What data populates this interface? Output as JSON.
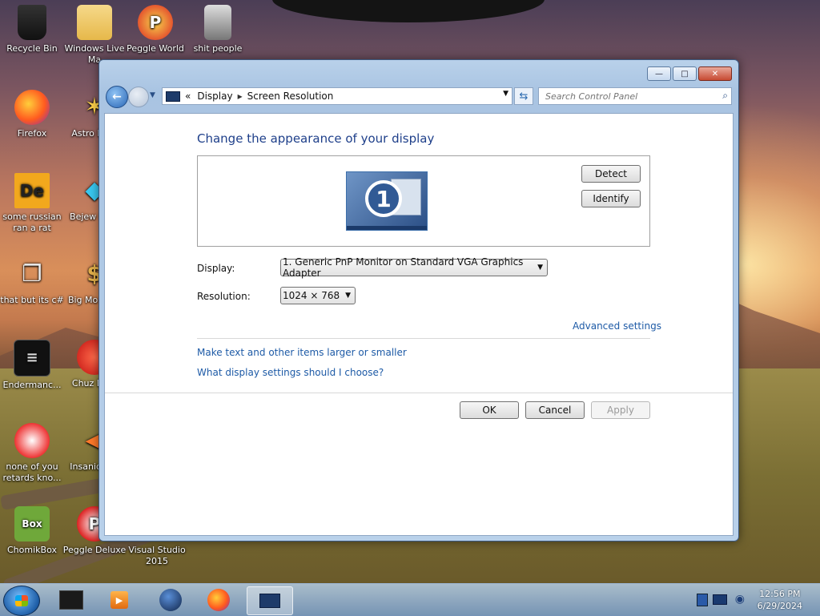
{
  "desktop": {
    "icons": [
      {
        "label": "Recycle Bin",
        "icon": "recycle-bin-icon"
      },
      {
        "label": "Windows Live Ma",
        "icon": "windows-live-mail-icon"
      },
      {
        "label": "Peggle World",
        "icon": "peggle-icon"
      },
      {
        "label": "shit people",
        "icon": "folder-icon"
      },
      {
        "label": "Firefox",
        "icon": "firefox-icon"
      },
      {
        "label": "Astro Delu",
        "icon": "astro-icon"
      },
      {
        "label": "some russian ran a rat",
        "icon": "de-icon"
      },
      {
        "label": "Bejew Delu",
        "icon": "gem-icon"
      },
      {
        "label": "that but its c#",
        "icon": "copy-icon"
      },
      {
        "label": "Big Mo Delu",
        "icon": "money-bag-icon"
      },
      {
        "label": "Endermanc...",
        "icon": "console-icon"
      },
      {
        "label": "Chuz Delu",
        "icon": "chuzzle-icon"
      },
      {
        "label": "none of you retards kno...",
        "icon": "dragon-icon"
      },
      {
        "label": "Insaniq Del",
        "icon": "fish-icon"
      },
      {
        "label": "ChomikBox",
        "icon": "chomikbox-icon"
      },
      {
        "label": "Peggle Deluxe",
        "icon": "peggle-deluxe-icon"
      },
      {
        "label": "Visual Studio 2015",
        "icon": "visual-studio-icon"
      }
    ]
  },
  "window": {
    "caption": {
      "minimize": "—",
      "maximize": "□",
      "close": "✕"
    },
    "address": {
      "prefix": "«",
      "crumb1": "Display",
      "sep": "▸",
      "crumb2": "Screen Resolution"
    },
    "search_placeholder": "Search Control Panel",
    "heading": "Change the appearance of your display",
    "monitor_number": "1",
    "detect_label": "Detect",
    "identify_label": "Identify",
    "display_label": "Display:",
    "display_value": "1. Generic PnP Monitor on Standard VGA Graphics Adapter",
    "resolution_label": "Resolution:",
    "resolution_value": "1024 × 768",
    "advanced_link": "Advanced settings",
    "link_text_size": "Make text and other items larger or smaller",
    "link_which_settings": "What display settings should I choose?",
    "ok_label": "OK",
    "cancel_label": "Cancel",
    "apply_label": "Apply"
  },
  "taskbar": {
    "items": [
      "start",
      "dark-app-icon",
      "media-player-icon",
      "globe-icon",
      "firefox-icon",
      "control-panel-icon"
    ],
    "clock_time": "12:56 PM",
    "clock_date": "6/29/2024"
  }
}
